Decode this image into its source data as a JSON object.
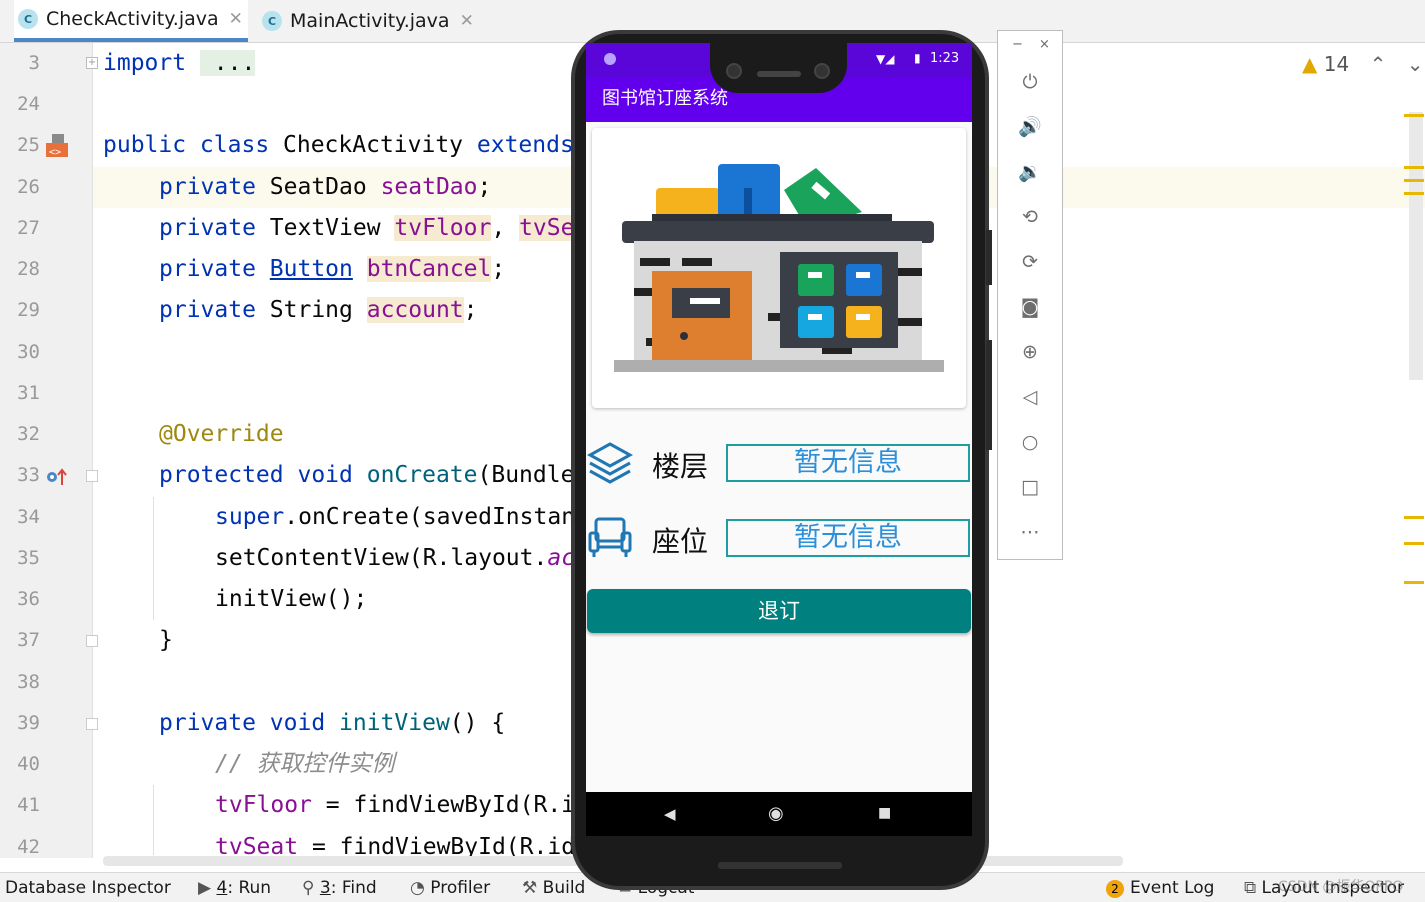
{
  "tabs": [
    {
      "label": "CheckActivity.java",
      "icon": "C",
      "active": true
    },
    {
      "label": "MainActivity.java",
      "icon": "C",
      "active": false
    }
  ],
  "line_numbers": [
    "3",
    "24",
    "25",
    "26",
    "27",
    "28",
    "29",
    "30",
    "31",
    "32",
    "33",
    "34",
    "35",
    "36",
    "37",
    "38",
    "39",
    "40",
    "41",
    "42"
  ],
  "code": {
    "l3_kw": "import",
    "l3_fold": " ...",
    "l25_kw1": "public class ",
    "l25_name": "CheckActivity ",
    "l25_kw2": "extends",
    "l26_kw": "private ",
    "l26_type": "SeatDao ",
    "l26_field": "seatDao",
    "l26_end": ";",
    "l27_kw": "private ",
    "l27_type": "TextView ",
    "l27_field1": "tvFloor",
    "l27_sep": ", ",
    "l27_field2": "tvSe",
    "l28_kw": "private ",
    "l28_type": "Button",
    "l28_sp": " ",
    "l28_field": "btnCancel",
    "l28_end": ";",
    "l29_kw": "private ",
    "l29_type": "String ",
    "l29_field": "account",
    "l29_end": ";",
    "l32_ann": "@Override",
    "l33_kw": "protected void ",
    "l33_mth": "onCreate",
    "l33_rest": "(Bundle",
    "l34_kw": "super",
    "l34_rest": ".onCreate(savedInstan",
    "l35_pre": "setContentView(R.layout.",
    "l35_fld": "ac",
    "l36": "initView();",
    "l37": "}",
    "l39_kw": "private void ",
    "l39_mth": "initView",
    "l39_rest": "() {",
    "l40_cmt": "// 获取控件实例",
    "l41_fld": "tvFloor",
    "l41_rest": " = findViewById(R.i",
    "l42_fld": "tvSeat",
    "l42_rest": " = findViewById(R.id"
  },
  "inspection": {
    "count": "14"
  },
  "statusbar": {
    "db": "Database Inspector",
    "run_key": "4",
    "run": ": Run",
    "find_key": "3",
    "find": ": Find",
    "profiler": "Profiler",
    "build": "Build",
    "logcat": "Logcat",
    "event_count": "2",
    "event_log": "Event Log",
    "layout_inspector": "Layout Inspector"
  },
  "phone": {
    "time": "1:23",
    "app_title": "图书馆订座系统",
    "floor_label": "楼层",
    "floor_value": "暂无信息",
    "seat_label": "座位",
    "seat_value": "暂无信息",
    "cancel_label": "退订"
  },
  "emulator": {
    "minimize": "−",
    "close": "×",
    "buttons": [
      "power-icon",
      "volume-up-icon",
      "volume-down-icon",
      "rotate-left-icon",
      "rotate-right-icon",
      "camera-icon",
      "zoom-icon",
      "back-icon",
      "home-icon",
      "overview-icon",
      "more-icon"
    ]
  },
  "watermark": "CSDN @振华OPPO",
  "colors": {
    "accent": "#6200ee",
    "teal": "#00807f",
    "keyword": "#0033b3",
    "field": "#871094"
  }
}
